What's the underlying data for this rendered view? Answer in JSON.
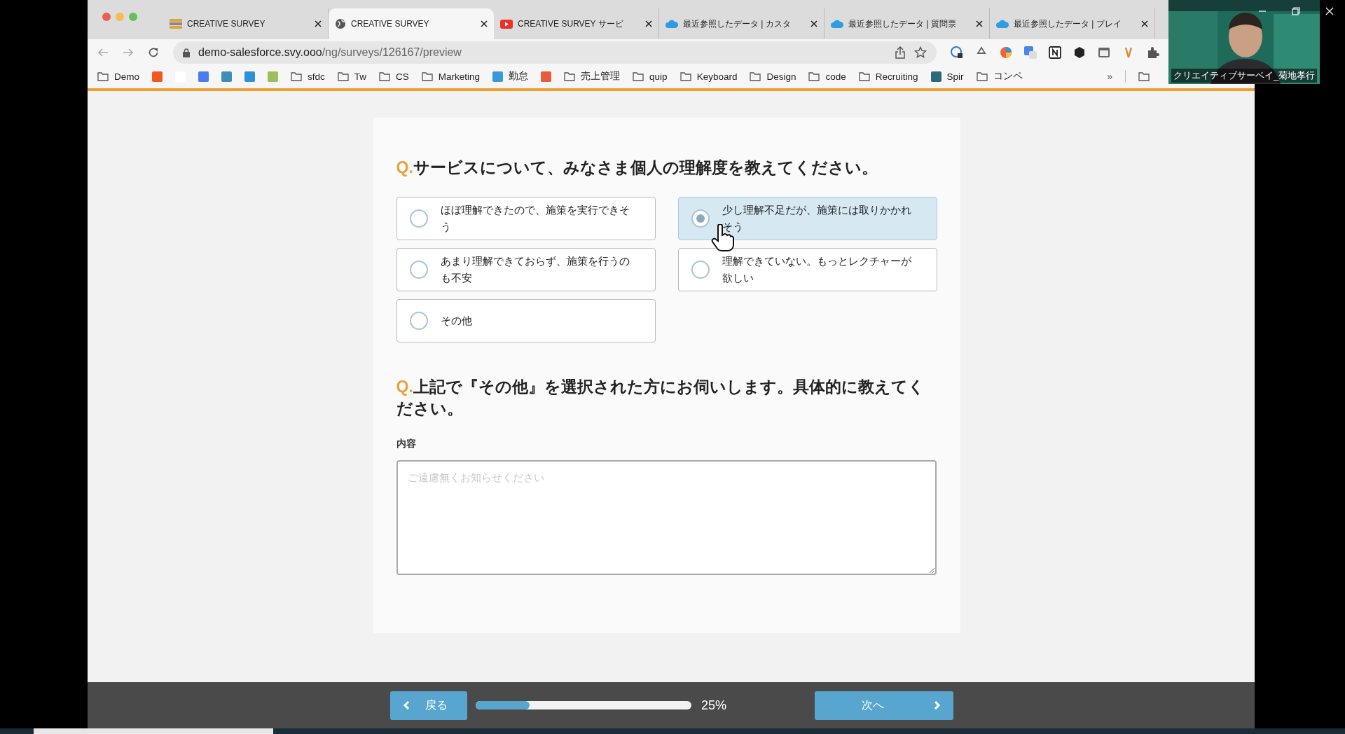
{
  "browser": {
    "tabs": [
      {
        "title": "CREATIVE SURVEY",
        "kind": "survey",
        "selected": false
      },
      {
        "title": "CREATIVE SURVEY",
        "kind": "globe",
        "selected": true
      },
      {
        "title": "CREATIVE SURVEY サービ",
        "kind": "video",
        "selected": false
      },
      {
        "title": "最近参照したデータ | カスタ",
        "kind": "cloud",
        "selected": false
      },
      {
        "title": "最近参照したデータ | 質問票",
        "kind": "cloud",
        "selected": false
      },
      {
        "title": "最近参照したデータ | プレイ",
        "kind": "cloud",
        "selected": false
      }
    ],
    "address": {
      "host": "demo-salesforce.svy.ooo",
      "path": "/ng/surveys/126167/preview"
    },
    "bookmarks": [
      {
        "kind": "folder",
        "label": "Demo"
      },
      {
        "kind": "app",
        "color": "#f05a22"
      },
      {
        "kind": "app",
        "color": "#ffffff"
      },
      {
        "kind": "app",
        "color": "#4a7cf0"
      },
      {
        "kind": "app",
        "color": "#3d8fb5"
      },
      {
        "kind": "app",
        "color": "#2f8fd8"
      },
      {
        "kind": "app",
        "color": "#9bbf5a"
      },
      {
        "kind": "folder",
        "label": "sfdc"
      },
      {
        "kind": "folder",
        "label": "Tw"
      },
      {
        "kind": "folder",
        "label": "CS"
      },
      {
        "kind": "folder",
        "label": "Marketing"
      },
      {
        "kind": "app",
        "color": "#3a9ad9",
        "label": "勤怠"
      },
      {
        "kind": "app",
        "color": "#e85c3a"
      },
      {
        "kind": "folder",
        "label": "売上管理"
      },
      {
        "kind": "folder",
        "label": "quip"
      },
      {
        "kind": "folder",
        "label": "Keyboard"
      },
      {
        "kind": "folder",
        "label": "Design"
      },
      {
        "kind": "folder",
        "label": "code"
      },
      {
        "kind": "folder",
        "label": "Recruiting"
      },
      {
        "kind": "app",
        "color": "#2a6a7a",
        "label": "Spir"
      },
      {
        "kind": "folder",
        "label": "コンペ"
      }
    ],
    "more": "»"
  },
  "survey": {
    "questions": [
      {
        "kind": "choice",
        "mark": "Q.",
        "text": "サービスについて、みなさま個人の理解度を教えてください。",
        "options": [
          {
            "label": "ほぼ理解できたので、施策を実行できそう",
            "selected": false
          },
          {
            "label": "少し理解不足だが、施策には取りかかれそう",
            "selected": true
          },
          {
            "label": "あまり理解できておらず、施策を行うのも不安",
            "selected": false
          },
          {
            "label": "理解できていない。もっとレクチャーが欲しい",
            "selected": false
          },
          {
            "label": "その他",
            "selected": false
          }
        ]
      },
      {
        "kind": "text",
        "mark": "Q.",
        "text": "上記で『その他』を選択された方にお伺いします。具体的に教えてください。",
        "field_label": "内容",
        "placeholder": "ご遠慮無くお知らせください"
      }
    ],
    "footer": {
      "back": "戻る",
      "next": "次へ",
      "progress": {
        "level": 0.25,
        "reading": "25%"
      }
    }
  },
  "video": {
    "caption": "クリエイティブサーベイ_菊地孝行"
  }
}
